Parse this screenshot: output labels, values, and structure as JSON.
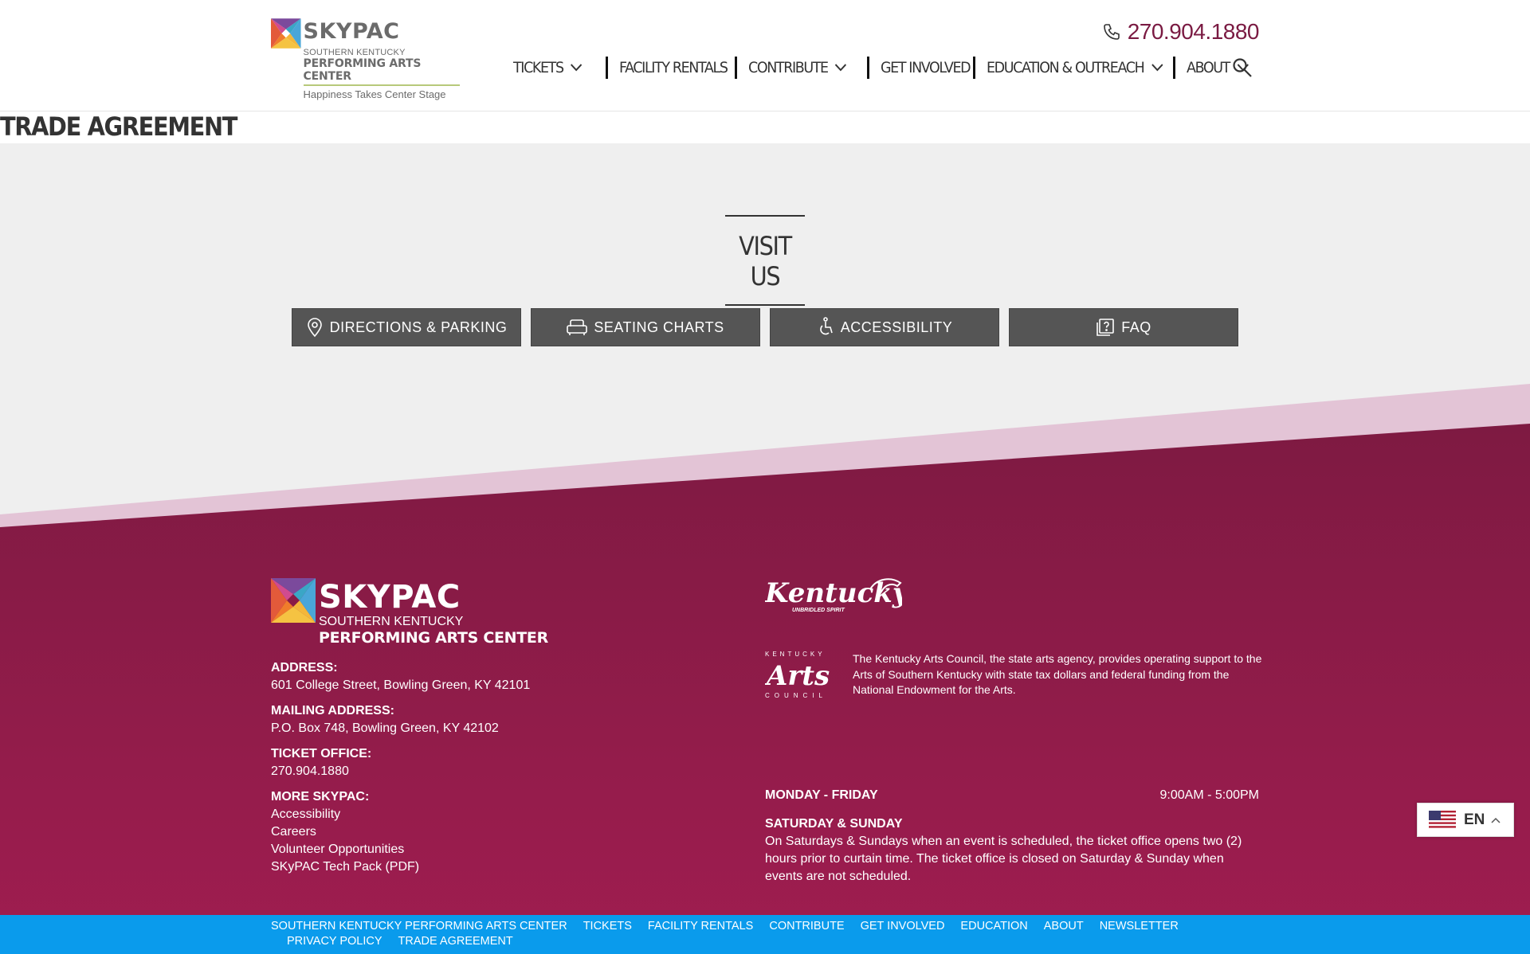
{
  "header": {
    "logo": {
      "name": "SKYPAC",
      "sub1": "SOUTHERN KENTUCKY",
      "sub2": "PERFORMING ARTS CENTER",
      "tagline": "Happiness Takes Center Stage"
    },
    "phone": "270.904.1880",
    "nav": [
      {
        "label": "TICKETS",
        "dropdown": true
      },
      {
        "label": "FACILITY RENTALS",
        "dropdown": false
      },
      {
        "label": "CONTRIBUTE",
        "dropdown": true
      },
      {
        "label": "GET INVOLVED",
        "dropdown": false
      },
      {
        "label": "EDUCATION & OUTREACH",
        "dropdown": true
      },
      {
        "label": "ABOUT",
        "dropdown": true
      }
    ]
  },
  "page": {
    "title": "TRADE AGREEMENT"
  },
  "visit": {
    "heading": "VISIT US",
    "buttons": [
      {
        "label": "DIRECTIONS & PARKING",
        "icon": "map-pin-icon"
      },
      {
        "label": "SEATING CHARTS",
        "icon": "seat-icon"
      },
      {
        "label": "ACCESSIBILITY",
        "icon": "accessibility-icon"
      },
      {
        "label": "FAQ",
        "icon": "faq-icon"
      }
    ]
  },
  "footer": {
    "logo": {
      "name": "SKYPAC",
      "sub1": "SOUTHERN KENTUCKY",
      "sub2": "PERFORMING ARTS CENTER"
    },
    "address_label": "ADDRESS:",
    "address": "601 College Street, Bowling Green, KY 42101",
    "mailing_label": "MAILING ADDRESS:",
    "mailing": "P.O. Box 748, Bowling Green, KY 42102",
    "ticket_label": "TICKET OFFICE:",
    "ticket_phone": "270.904.1880",
    "more_label": "MORE SKYPAC:",
    "more_links": [
      "Accessibility",
      "Careers",
      "Volunteer Opportunities",
      "SKyPAC Tech Pack (PDF)"
    ],
    "kentucky_logo": "Kentucky",
    "kentucky_tagline": "UNBRIDLED SPIRIT",
    "kac_top": "KENTUCKY",
    "kac_mid": "Arts",
    "kac_bottom": "COUNCIL",
    "kac_text": "The Kentucky Arts Council, the state arts agency, provides operating support to the Arts of  Southern Kentucky with state tax dollars and federal funding from the National Endowment for the Arts.",
    "hours_weekday_label": "MONDAY - FRIDAY",
    "hours_weekday_time": "9:00AM - 5:00PM",
    "hours_weekend_label": "SATURDAY & SUNDAY",
    "hours_weekend_note": "On Saturdays & Sundays when an event is scheduled, the ticket office opens two (2) hours prior to curtain time. The ticket office is closed on Saturday & Sunday when events are not scheduled."
  },
  "bottom_links": [
    "SOUTHERN KENTUCKY PERFORMING ARTS CENTER",
    "TICKETS",
    "FACILITY RENTALS",
    "CONTRIBUTE",
    "GET INVOLVED",
    "EDUCATION",
    "ABOUT",
    "NEWSLETTER",
    "PRIVACY POLICY",
    "TRADE AGREEMENT"
  ],
  "language": {
    "code": "EN"
  },
  "colors": {
    "brand": "#7a1a42",
    "footer_bg": "#8b1a47",
    "footer_band": "#e3c4d6",
    "bottom_bar": "#0a9bec",
    "button_bg": "#555555"
  }
}
